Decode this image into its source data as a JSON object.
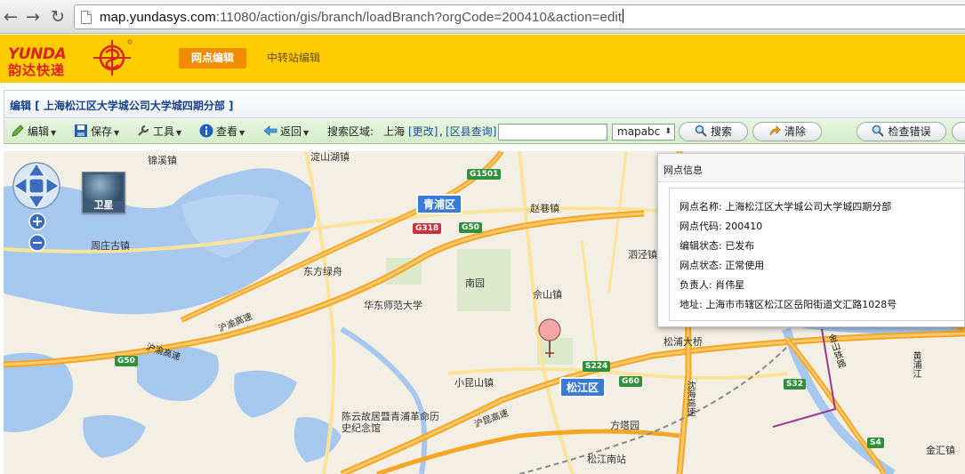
{
  "browser": {
    "url_host": "map.yundasys.com",
    "url_rest": ":11080/action/gis/branch/loadBranch?orgCode=200410&action=edit"
  },
  "header": {
    "logo_en": "YUNDA",
    "logo_cn": "韵达快递",
    "tabs": [
      {
        "label": "网点编辑",
        "active": true
      },
      {
        "label": "中转站编辑",
        "active": false
      }
    ]
  },
  "panel": {
    "title": "编辑 [ 上海松江区大学城公司大学城四期分部 ]"
  },
  "toolbar": {
    "edit": "编辑",
    "save": "保存",
    "tools": "工具",
    "view": "查看",
    "back": "返回",
    "search_area_label": "搜索区域:",
    "search_area_value": "上海",
    "change_link": "[更改]",
    "district_link": "[区县查询]",
    "search_value": "",
    "provider": "mapabc",
    "search_btn": "搜索",
    "clear_btn": "清除",
    "check_btn": "检查错误"
  },
  "map": {
    "satellite_label": "卫星",
    "districts": [
      "青浦区",
      "松江区"
    ],
    "places": [
      "锦溪镇",
      "淀山湖镇",
      "赵巷镇",
      "泗泾镇",
      "周庄古镇",
      "东方绿舟",
      "南园",
      "佘山镇",
      "华东师范大学",
      "松浦大桥",
      "小昆山镇",
      "陈云故居暨青浦革命历史纪念馆",
      "方塔园",
      "松江南站",
      "金汇镇"
    ],
    "road_shields": [
      "G1501",
      "G318",
      "G50",
      "G50",
      "S224",
      "G60",
      "S32",
      "S4"
    ],
    "road_names": [
      "沪渝高速",
      "沪渝高速",
      "沪昆高速",
      "沈海高速",
      "黄浦江",
      "金山铁路"
    ]
  },
  "info": {
    "header": "网点信息",
    "rows": [
      {
        "label": "网点名称:",
        "value": "上海松江区大学城公司大学城四期分部"
      },
      {
        "label": "网点代码:",
        "value": "200410"
      },
      {
        "label": "编辑状态:",
        "value": "已发布"
      },
      {
        "label": "网点状态:",
        "value": "正常使用"
      },
      {
        "label": "负责人:",
        "value": "肖伟星"
      },
      {
        "label": "地址:",
        "value": "上海市市辖区松江区岳阳街道文汇路1028号"
      }
    ]
  },
  "colors": {
    "brand_yellow": "#ffcc00",
    "brand_red": "#d9251d",
    "tab_active": "#f08c00",
    "toolbar_green": "#d4ecc7",
    "water": "#a7c8ee",
    "highway": "#f5a623"
  }
}
